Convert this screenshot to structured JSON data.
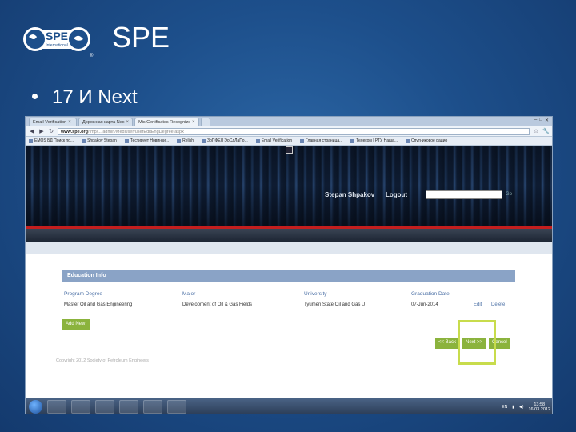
{
  "slide": {
    "title": "SPE",
    "bullet": "17 И Next",
    "logo_text": "SPE",
    "logo_sub": "International"
  },
  "browser": {
    "tabs": [
      "Email Verification",
      "Дорожная карта Nex",
      "Mis Certificates Recognize"
    ],
    "url_domain": "www.spe.org",
    "url_path": "/tmp/.../admin/MedUser/userEditEngDegree.aspx",
    "bookmarks": [
      "EMOS БД Поиск по...",
      "Shpakov Stepan",
      "Тестирует Новинки...",
      "Relish",
      "ЗоПФЕЛ ЭоСдЛаПо...",
      "Email Verification",
      "Главная страница...",
      "Телеком | РТУ Наша...",
      "Спутниковое радио"
    ]
  },
  "site": {
    "user_name": "Stepan Shpakov",
    "logout": "Logout",
    "search_go": "Go"
  },
  "education": {
    "header": "Education Info",
    "columns": [
      "Program Degree",
      "Major",
      "University",
      "Graduation Date"
    ],
    "row": {
      "degree": "Master Oil and Gas Engineering",
      "major": "Development of Oil & Gas Fields",
      "university": "Tyumen State Oil and Gas U",
      "date": "07-Jun-2014",
      "edit": "Edit",
      "delete": "Delete"
    },
    "add_new": "Add New",
    "back": "<< Back",
    "next": "Next >>",
    "cancel": "Cancel",
    "copyright": "Copyright 2012 Society of Petroleum Engineers"
  },
  "taskbar": {
    "lang": "EN",
    "time": "13:58",
    "date": "16.03.2012"
  }
}
